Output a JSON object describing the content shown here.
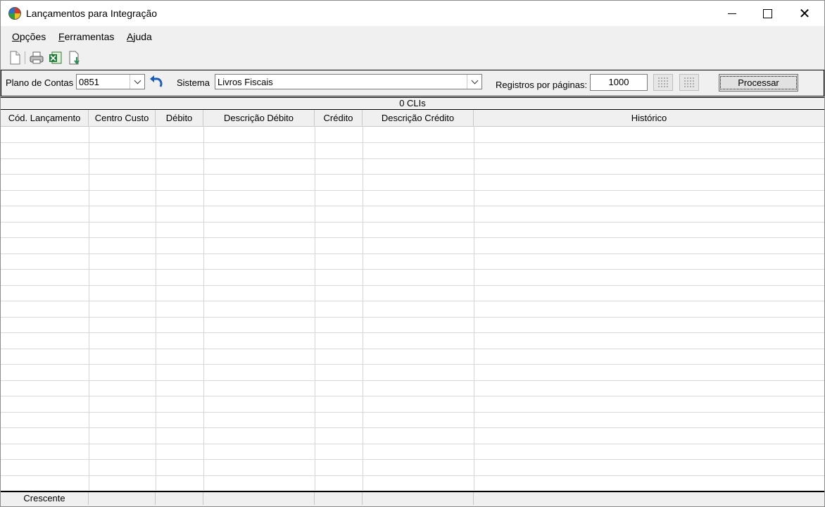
{
  "window": {
    "title": "Lançamentos para Integração",
    "controls": {
      "minimize": "minimize-icon",
      "maximize": "maximize-icon",
      "close": "close-icon"
    }
  },
  "menu": {
    "items": [
      {
        "first": "O",
        "rest": "pções"
      },
      {
        "first": "F",
        "rest": "erramentas"
      },
      {
        "first": "A",
        "rest": "juda"
      }
    ]
  },
  "toolbar": {
    "icons": [
      "new-document-icon",
      "print-icon",
      "excel-export-icon",
      "import-icon"
    ]
  },
  "filters": {
    "plano_label": "Plano de Contas",
    "plano_value": "0851",
    "sistema_label": "Sistema",
    "sistema_value": "Livros Fiscais",
    "registros_label": "Registros por páginas:",
    "registros_value": "1000",
    "process_label": "Processar"
  },
  "grid": {
    "caption": "0 CLIs",
    "columns": [
      "Cód. Lançamento",
      "Centro Custo",
      "Débito",
      "Descrição Débito",
      "Crédito",
      "Descrição Crédito",
      "Histórico"
    ],
    "rows": []
  },
  "footer": {
    "cells": [
      "Crescente",
      "",
      "",
      "",
      "",
      "",
      ""
    ]
  }
}
